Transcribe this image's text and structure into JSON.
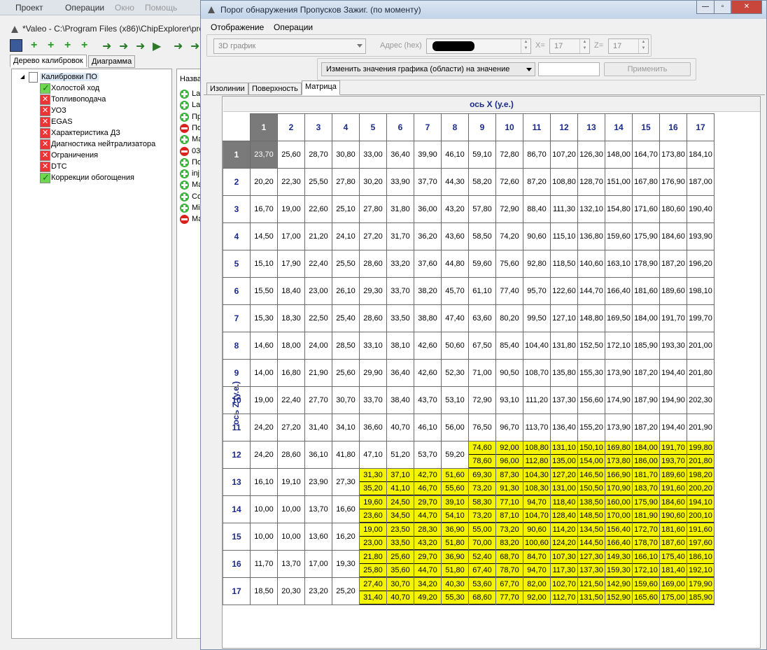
{
  "main": {
    "menu": [
      "Проект",
      "Операции",
      "Окно",
      "Помощь"
    ],
    "title": "*Valeo - C:\\Program Files (x86)\\ChipExplorer\\pro",
    "tabs": [
      "Дерево калибровок",
      "Диаграмма"
    ],
    "tree_root": "Калибровки ПО",
    "tree_items": [
      {
        "label": "Холостой ход",
        "status": "ok"
      },
      {
        "label": "Топливоподача",
        "status": "err"
      },
      {
        "label": "УОЗ",
        "status": "err"
      },
      {
        "label": "EGAS",
        "status": "err"
      },
      {
        "label": "Характеристика ДЗ",
        "status": "err"
      },
      {
        "label": "Диагностика нейтрализатора",
        "status": "err"
      },
      {
        "label": "Ограничения",
        "status": "err"
      },
      {
        "label": "DTC",
        "status": "err"
      },
      {
        "label": "Коррекции обогощения",
        "status": "ok"
      }
    ],
    "list_header": "Назва",
    "list_items": [
      {
        "label": "Lau",
        "status": "g"
      },
      {
        "label": "Lau",
        "status": "g"
      },
      {
        "label": "Пр",
        "status": "g"
      },
      {
        "label": "По",
        "status": "r"
      },
      {
        "label": "Ма",
        "status": "g"
      },
      {
        "label": "03",
        "status": "r"
      },
      {
        "label": "По",
        "status": "g"
      },
      {
        "label": "inj",
        "status": "g"
      },
      {
        "label": "Ма",
        "status": "g"
      },
      {
        "label": "Co",
        "status": "g"
      },
      {
        "label": "Mir",
        "status": "g"
      },
      {
        "label": "Ма",
        "status": "r"
      }
    ]
  },
  "window": {
    "title": "Порог обнаружения Пропусков Зажиг. (по моменту)",
    "menu": [
      "Отображение",
      "Операции"
    ],
    "view_select": "3D график",
    "address_label": "Адрес (hex)",
    "x_label": "X=",
    "x_value": "17",
    "z_label": "Z=",
    "z_value": "17",
    "change_select": "Изменить значения графика (области) на значение",
    "change_value": "",
    "apply_button": "Применить",
    "tabs": [
      "Изолинии",
      "Поверхность",
      "Матрица"
    ],
    "x_axis_label": "ось X (у.е.)",
    "z_axis_label": "ось Z (у.е.)"
  },
  "matrix": {
    "x": [
      "1",
      "2",
      "3",
      "4",
      "5",
      "6",
      "7",
      "8",
      "9",
      "10",
      "11",
      "12",
      "13",
      "14",
      "15",
      "16",
      "17"
    ],
    "z": [
      "1",
      "2",
      "3",
      "4",
      "5",
      "6",
      "7",
      "8",
      "9",
      "10",
      "11",
      "12",
      "13",
      "14",
      "15",
      "16",
      "17"
    ],
    "rows": [
      [
        "23,70",
        "25,60",
        "28,70",
        "30,80",
        "33,00",
        "36,40",
        "39,90",
        "46,10",
        "59,10",
        "72,80",
        "86,70",
        "107,20",
        "126,30",
        "148,00",
        "164,70",
        "173,80",
        "184,10"
      ],
      [
        "20,20",
        "22,30",
        "25,50",
        "27,80",
        "30,20",
        "33,90",
        "37,70",
        "44,30",
        "58,20",
        "72,60",
        "87,20",
        "108,80",
        "128,70",
        "151,00",
        "167,80",
        "176,90",
        "187,00"
      ],
      [
        "16,70",
        "19,00",
        "22,60",
        "25,10",
        "27,80",
        "31,80",
        "36,00",
        "43,20",
        "57,80",
        "72,90",
        "88,40",
        "111,30",
        "132,10",
        "154,80",
        "171,60",
        "180,60",
        "190,40"
      ],
      [
        "14,50",
        "17,00",
        "21,20",
        "24,10",
        "27,20",
        "31,70",
        "36,20",
        "43,60",
        "58,50",
        "74,20",
        "90,60",
        "115,10",
        "136,80",
        "159,60",
        "175,90",
        "184,60",
        "193,90"
      ],
      [
        "15,10",
        "17,90",
        "22,40",
        "25,50",
        "28,60",
        "33,20",
        "37,60",
        "44,80",
        "59,60",
        "75,60",
        "92,80",
        "118,50",
        "140,60",
        "163,10",
        "178,90",
        "187,20",
        "196,20"
      ],
      [
        "15,50",
        "18,40",
        "23,00",
        "26,10",
        "29,30",
        "33,70",
        "38,20",
        "45,70",
        "61,10",
        "77,40",
        "95,70",
        "122,60",
        "144,70",
        "166,40",
        "181,60",
        "189,60",
        "198,10"
      ],
      [
        "15,30",
        "18,30",
        "22,50",
        "25,40",
        "28,60",
        "33,50",
        "38,80",
        "47,40",
        "63,60",
        "80,20",
        "99,50",
        "127,10",
        "148,80",
        "169,50",
        "184,00",
        "191,70",
        "199,70"
      ],
      [
        "14,60",
        "18,00",
        "24,00",
        "28,50",
        "33,10",
        "38,10",
        "42,60",
        "50,60",
        "67,50",
        "85,40",
        "104,40",
        "131,80",
        "152,50",
        "172,10",
        "185,90",
        "193,30",
        "201,00"
      ],
      [
        "14,00",
        "16,80",
        "21,90",
        "25,60",
        "29,90",
        "36,40",
        "42,60",
        "52,30",
        "71,00",
        "90,50",
        "108,70",
        "135,80",
        "155,30",
        "173,90",
        "187,20",
        "194,40",
        "201,80"
      ],
      [
        "19,00",
        "22,40",
        "27,70",
        "30,70",
        "33,70",
        "38,40",
        "43,70",
        "53,10",
        "72,90",
        "93,10",
        "111,20",
        "137,30",
        "156,60",
        "174,90",
        "187,90",
        "194,90",
        "202,30"
      ],
      [
        "24,20",
        "27,20",
        "31,40",
        "34,10",
        "36,60",
        "40,70",
        "46,10",
        "56,00",
        "76,50",
        "96,70",
        "113,70",
        "136,40",
        "155,20",
        "173,90",
        "187,20",
        "194,40",
        "201,90"
      ],
      [
        "24,20",
        "28,60",
        "36,10",
        "41,80",
        "47,10",
        "51,20",
        "53,70",
        "59,20",
        [
          "74,60",
          "78,60"
        ],
        [
          "92,00",
          "96,00"
        ],
        [
          "108,80",
          "112,80"
        ],
        [
          "131,10",
          "135,00"
        ],
        [
          "150,10",
          "154,00"
        ],
        [
          "169,80",
          "173,80"
        ],
        [
          "184,00",
          "186,00"
        ],
        [
          "191,70",
          "193,70"
        ],
        [
          "199,80",
          "201,80"
        ]
      ],
      [
        "16,10",
        "19,10",
        "23,90",
        "27,30",
        [
          "31,30",
          "35,20"
        ],
        [
          "37,10",
          "41,10"
        ],
        [
          "42,70",
          "46,70"
        ],
        [
          "51,60",
          "55,60"
        ],
        [
          "69,30",
          "73,20"
        ],
        [
          "87,30",
          "91,30"
        ],
        [
          "104,30",
          "108,30"
        ],
        [
          "127,20",
          "131,00"
        ],
        [
          "146,50",
          "150,50"
        ],
        [
          "166,90",
          "170,90"
        ],
        [
          "181,70",
          "183,70"
        ],
        [
          "189,60",
          "191,60"
        ],
        [
          "198,20",
          "200,20"
        ]
      ],
      [
        "10,00",
        "10,00",
        "13,70",
        "16,60",
        [
          "19,60",
          "23,60"
        ],
        [
          "24,50",
          "34,50"
        ],
        [
          "29,70",
          "44,70"
        ],
        [
          "39,10",
          "54,10"
        ],
        [
          "58,30",
          "73,20"
        ],
        [
          "77,10",
          "87,10"
        ],
        [
          "94,70",
          "104,70"
        ],
        [
          "118,40",
          "128,40"
        ],
        [
          "138,50",
          "148,50"
        ],
        [
          "160,00",
          "170,00"
        ],
        [
          "175,90",
          "181,90"
        ],
        [
          "184,60",
          "190,60"
        ],
        [
          "194,10",
          "200,10"
        ]
      ],
      [
        "10,00",
        "10,00",
        "13,60",
        "16,20",
        [
          "19,00",
          "23,00"
        ],
        [
          "23,50",
          "33,50"
        ],
        [
          "28,30",
          "43,20"
        ],
        [
          "36,90",
          "51,80"
        ],
        [
          "55,00",
          "70,00"
        ],
        [
          "73,20",
          "83,20"
        ],
        [
          "90,60",
          "100,60"
        ],
        [
          "114,20",
          "124,20"
        ],
        [
          "134,50",
          "144,50"
        ],
        [
          "156,40",
          "166,40"
        ],
        [
          "172,70",
          "178,70"
        ],
        [
          "181,60",
          "187,60"
        ],
        [
          "191,60",
          "197,60"
        ]
      ],
      [
        "11,70",
        "13,70",
        "17,00",
        "19,30",
        [
          "21,80",
          "25,80"
        ],
        [
          "25,60",
          "35,60"
        ],
        [
          "29,70",
          "44,70"
        ],
        [
          "36,90",
          "51,80"
        ],
        [
          "52,40",
          "67,40"
        ],
        [
          "68,70",
          "78,70"
        ],
        [
          "84,70",
          "94,70"
        ],
        [
          "107,30",
          "117,30"
        ],
        [
          "127,30",
          "137,30"
        ],
        [
          "149,30",
          "159,30"
        ],
        [
          "166,10",
          "172,10"
        ],
        [
          "175,40",
          "181,40"
        ],
        [
          "186,10",
          "192,10"
        ]
      ],
      [
        "18,50",
        "20,30",
        "23,20",
        "25,20",
        [
          "27,40",
          "31,40"
        ],
        [
          "30,70",
          "40,70"
        ],
        [
          "34,20",
          "49,20"
        ],
        [
          "40,30",
          "55,30"
        ],
        [
          "53,60",
          "68,60"
        ],
        [
          "67,70",
          "77,70"
        ],
        [
          "82,00",
          "92,00"
        ],
        [
          "102,70",
          "112,70"
        ],
        [
          "121,50",
          "131,50"
        ],
        [
          "142,90",
          "152,90"
        ],
        [
          "159,60",
          "165,60"
        ],
        [
          "169,00",
          "175,00"
        ],
        [
          "179,90",
          "185,90"
        ]
      ]
    ]
  }
}
